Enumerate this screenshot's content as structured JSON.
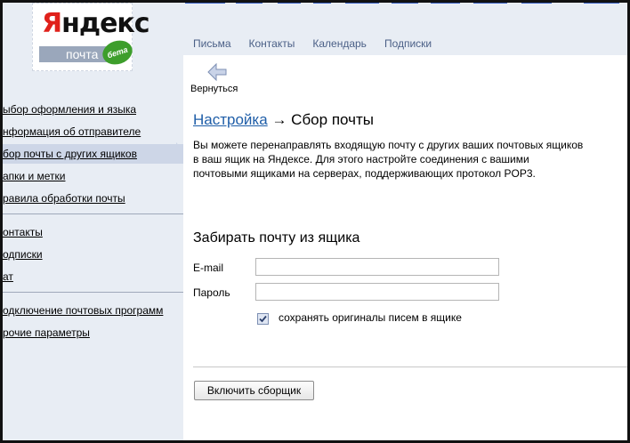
{
  "logo": {
    "word_first": "Я",
    "word_rest": "ндекс",
    "service": "почта",
    "badge": "бета"
  },
  "topnav": [
    "Письма",
    "Контакты",
    "Календарь",
    "Подписки"
  ],
  "back_label": "Вернуться",
  "sidebar": {
    "groups": [
      [
        "ыбор оформления и языка",
        "нформация об отправителе",
        "бор почты с других ящиков",
        "апки и метки",
        "равила обработки почты"
      ],
      [
        "онтакты",
        "одписки",
        "ат"
      ],
      [
        "одключение почтовых программ",
        "рочие параметры"
      ]
    ],
    "active": "бор почты с других ящиков"
  },
  "breadcrumb": {
    "link": "Настройка",
    "separator": "→",
    "current": "Сбор почты"
  },
  "description": "Вы можете перенаправлять входящую почту с других ваших почтовых ящиков в ваш ящик на Яндексе. Для этого настройте соединения с вашими почтовыми ящиками на серверах, поддерживающих протокол POP3.",
  "form": {
    "heading": "Забирать почту из ящика",
    "email_label": "E-mail",
    "email_value": "",
    "password_label": "Пароль",
    "password_value": "",
    "keep_originals_checked": true,
    "keep_originals_label": "сохранять оригиналы писем в ящике",
    "submit_label": "Включить сборщик"
  },
  "colors": {
    "link": "#1f5ea8",
    "nav": "#4a5f86",
    "sidebar_active": "#cdd6e7",
    "page_bg": "#e8edf4",
    "logo_red": "#e0211b"
  }
}
